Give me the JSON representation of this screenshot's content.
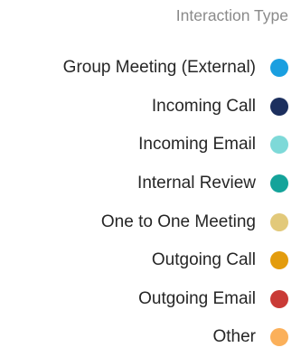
{
  "legend": {
    "title": "Interaction Type",
    "items": [
      {
        "label": "Group Meeting (External)",
        "color": "#1a9fe0"
      },
      {
        "label": "Incoming Call",
        "color": "#1c2f5e"
      },
      {
        "label": "Incoming Email",
        "color": "#7ed9d8"
      },
      {
        "label": "Internal Review",
        "color": "#14a39a"
      },
      {
        "label": "One to One Meeting",
        "color": "#e2c97a"
      },
      {
        "label": "Outgoing Call",
        "color": "#e39c0d"
      },
      {
        "label": "Outgoing Email",
        "color": "#c93a36"
      },
      {
        "label": "Other",
        "color": "#fbb05a"
      }
    ]
  }
}
